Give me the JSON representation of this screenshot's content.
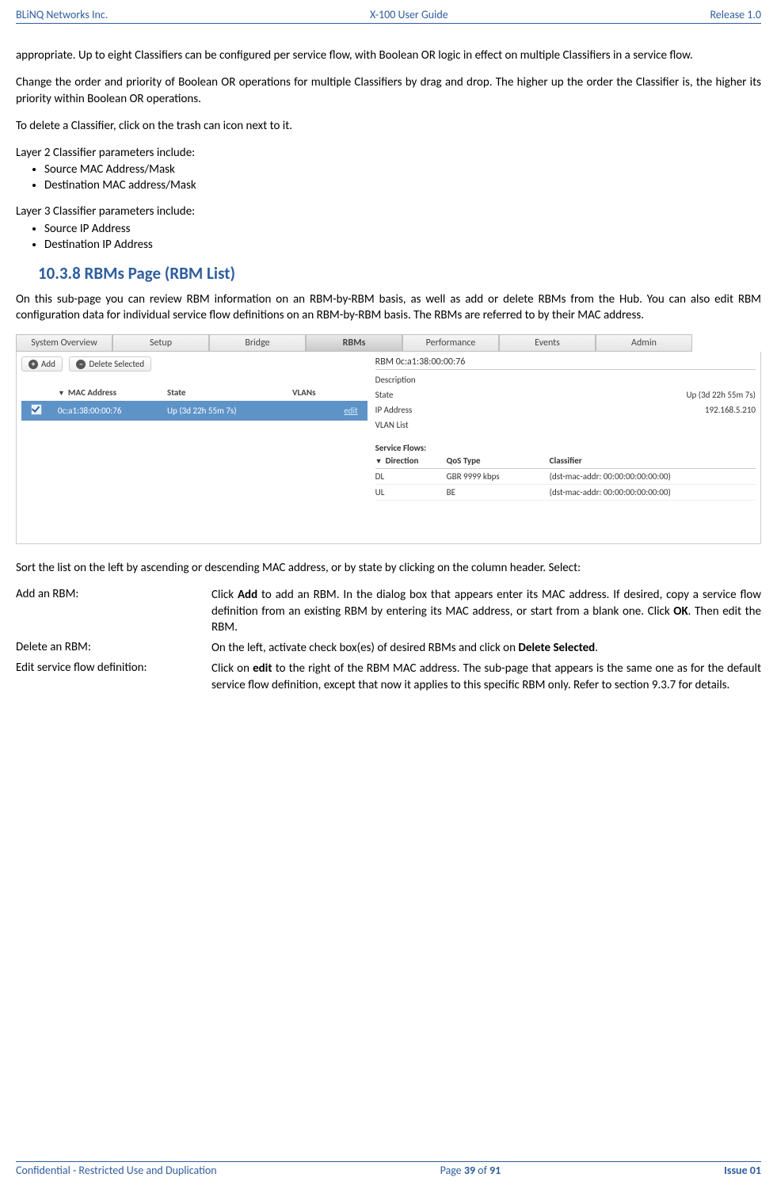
{
  "header": {
    "left": "BLiNQ Networks Inc.",
    "center": "X-100 User Guide",
    "right": "Release 1.0"
  },
  "footer": {
    "left": "Confidential - Restricted Use and Duplication",
    "center_pre": "Page ",
    "center_page": "39",
    "center_mid": " of ",
    "center_total": "91",
    "right": "Issue 01"
  },
  "p1": "appropriate.  Up to eight Classifiers can be configured per service flow, with Boolean OR logic in effect on multiple Classifiers in a service flow.",
  "p2": "Change the order and priority of Boolean OR operations for multiple Classifiers by drag and drop. The higher up the order the Classifier is, the higher its priority within Boolean OR operations.",
  "p3": "To delete a Classifier, click on the trash can icon next to it.",
  "l2_intro": "Layer 2 Classifier parameters include:",
  "l2_items": [
    "Source MAC Address/Mask",
    "Destination MAC address/Mask"
  ],
  "l3_intro": "Layer 3 Classifier parameters include:",
  "l3_items": [
    "Source IP Address",
    "Destination IP Address"
  ],
  "heading": "10.3.8   RBMs Page (RBM List)",
  "p4": "On this sub-page you can review RBM information on an RBM-by-RBM basis, as well as add or delete RBMs from the Hub. You can also edit RBM configuration data for individual service flow definitions on an RBM-by-RBM basis. The RBMs are referred to by their MAC address.",
  "tabs": [
    "System Overview",
    "Setup",
    "Bridge",
    "RBMs",
    "Performance",
    "Events",
    "Admin"
  ],
  "ss": {
    "add": "Add",
    "del": "Delete Selected",
    "cols": {
      "mac": "MAC Address",
      "state": "State",
      "vlans": "VLANs"
    },
    "row": {
      "mac": "0c:a1:38:00:00:76",
      "state": "Up (3d 22h 55m 7s)",
      "edit": "edit"
    },
    "panel_title": "RBM 0c:a1:38:00:00:76",
    "kv": {
      "desc_k": "Description",
      "desc_v": "",
      "state_k": "State",
      "state_v": "Up (3d 22h 55m 7s)",
      "ip_k": "IP Address",
      "ip_v": "192.168.5.210",
      "vlan_k": "VLAN List",
      "vlan_v": ""
    },
    "sf_title": "Service Flows:",
    "sf_cols": {
      "dir": "Direction",
      "qos": "QoS Type",
      "cls": "Classifier"
    },
    "sf_rows": [
      {
        "dir": "DL",
        "qos": "GBR 9999 kbps",
        "cls": "(dst-mac-addr: 00:00:00:00:00:00)"
      },
      {
        "dir": "UL",
        "qos": "BE",
        "cls": "(dst-mac-addr: 00:00:00:00:00:00)"
      }
    ]
  },
  "p5": "Sort the list on the left by ascending or descending MAC address, or by state by clicking on the column header. Select:",
  "defs": {
    "add_term": "Add an RBM:",
    "add_1": "Click ",
    "add_b1": "Add",
    "add_2": " to add an RBM. In the dialog box that appears enter its MAC address. If desired, copy a service flow definition from an existing RBM by entering its MAC address, or start from a blank one. Click ",
    "add_b2": "OK",
    "add_3": ". Then edit the RBM.",
    "del_term": "Delete an RBM:",
    "del_1": "On the left, activate check box(es) of desired RBMs and click on ",
    "del_b1": "Delete Selected",
    "del_2": ".",
    "edit_term": "Edit service flow definition:",
    "edit_1": "Click on ",
    "edit_b1": "edit",
    "edit_2": " to the right of the RBM MAC address. The sub-page that appears is the same one as for the default service flow definition, except that now it applies to this specific RBM only. Refer to section 9.3.7 for details."
  }
}
